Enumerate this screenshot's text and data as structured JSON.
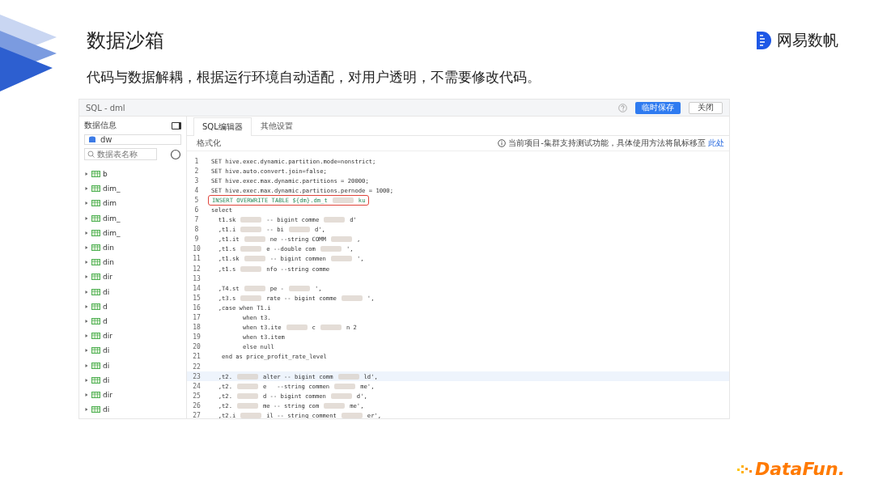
{
  "slide": {
    "title": "数据沙箱",
    "subtitle": "代码与数据解耦，根据运行环境自动适配，对用户透明，不需要修改代码。",
    "brand": "网易数帆",
    "footer_logo": "DataFun."
  },
  "window": {
    "title": "SQL - dml",
    "buttons": [
      {
        "label": "临时保存",
        "kind": "primary"
      },
      {
        "label": "关闭",
        "kind": "default"
      }
    ]
  },
  "sidebar": {
    "title": "数据信息",
    "database": "dw",
    "search": {
      "placeholder": "数据表名称"
    },
    "tables": [
      {
        "name": "b"
      },
      {
        "name": "dim_"
      },
      {
        "name": "dim"
      },
      {
        "name": "dim_"
      },
      {
        "name": "dim_"
      },
      {
        "name": "din"
      },
      {
        "name": "din"
      },
      {
        "name": "dir"
      },
      {
        "name": "di"
      },
      {
        "name": "d"
      },
      {
        "name": "d"
      },
      {
        "name": "dir"
      },
      {
        "name": "di"
      },
      {
        "name": "di"
      },
      {
        "name": "di"
      },
      {
        "name": "dir"
      },
      {
        "name": "di"
      }
    ]
  },
  "tabs": [
    {
      "label": "SQL编辑器",
      "selected": true
    },
    {
      "label": "其他设置",
      "selected": false
    }
  ],
  "toolbar": {
    "format": "格式化",
    "notice": "当前项目-集群支持测试功能，具体使用方法将鼠标移至",
    "notice_link": "此处"
  },
  "code": [
    {
      "n": "1",
      "parts": [
        "SET hive.exec.dynamic.partition.mode=nonstrict;"
      ],
      "boxed": false,
      "current": false
    },
    {
      "n": "2",
      "parts": [
        "SET hive.auto.convert.join=false;"
      ],
      "boxed": false,
      "current": false
    },
    {
      "n": "3",
      "parts": [
        "SET hive.exec.max.dynamic.partitions = 20000;"
      ],
      "boxed": false,
      "current": false
    },
    {
      "n": "4",
      "parts": [
        "SET hive.exec.max.dynamic.partitions.pernode = 1000;"
      ],
      "boxed": false,
      "current": false
    },
    {
      "n": "5",
      "parts": [
        "INSERT OVERWRITE TABLE ${dm}.dm_t",
        "ku"
      ],
      "boxed": true,
      "current": false
    },
    {
      "n": "6",
      "parts": [
        "select"
      ],
      "boxed": false,
      "current": false
    },
    {
      "n": "7",
      "parts": [
        "  t1.sk",
        "-- bigint comme",
        "d'"
      ],
      "boxed": false,
      "current": false
    },
    {
      "n": "8",
      "parts": [
        "  ,t1.i",
        "-- bi",
        "d',"
      ],
      "boxed": false,
      "current": false
    },
    {
      "n": "9",
      "parts": [
        "  ,t1.it",
        "ne --string COMM",
        ","
      ],
      "boxed": false,
      "current": false
    },
    {
      "n": "10",
      "parts": [
        "  ,t1.s",
        "e --double com",
        "',"
      ],
      "boxed": false,
      "current": false
    },
    {
      "n": "11",
      "parts": [
        "  ,t1.sk",
        "-- bigint commen",
        "',"
      ],
      "boxed": false,
      "current": false
    },
    {
      "n": "12",
      "parts": [
        "  ,t1.s",
        "nfo --string comme"
      ],
      "boxed": false,
      "current": false
    },
    {
      "n": "13",
      "boxed": false,
      "current": false
    },
    {
      "n": "14",
      "parts": [
        "  ,T4.st",
        "pe -",
        "',"
      ],
      "boxed": false,
      "current": false
    },
    {
      "n": "15",
      "parts": [
        "  ,t3.s",
        "rate -- bigint comme",
        "',"
      ],
      "boxed": false,
      "current": false
    },
    {
      "n": "16",
      "parts": [
        "  ,case when T1.i"
      ],
      "boxed": false,
      "current": false
    },
    {
      "n": "17",
      "parts": [
        "         when t3."
      ],
      "boxed": false,
      "current": false
    },
    {
      "n": "18",
      "parts": [
        "         when t3.ite",
        "c",
        "n 2"
      ],
      "boxed": false,
      "current": false
    },
    {
      "n": "19",
      "parts": [
        "         when t3.item"
      ],
      "boxed": false,
      "current": false
    },
    {
      "n": "20",
      "parts": [
        "         else null"
      ],
      "boxed": false,
      "current": false
    },
    {
      "n": "21",
      "parts": [
        "   end as price_profit_rate_level"
      ],
      "boxed": false,
      "current": false
    },
    {
      "n": "22",
      "boxed": false,
      "current": false
    },
    {
      "n": "23",
      "parts": [
        "  ,t2.",
        "alter -- bigint comm",
        "ld',"
      ],
      "boxed": false,
      "current": true
    },
    {
      "n": "24",
      "parts": [
        "  ,t2.",
        "e   --string commen",
        "me',"
      ],
      "boxed": false,
      "current": false
    },
    {
      "n": "25",
      "parts": [
        "  ,t2.",
        "d -- bigint commen",
        "d',"
      ],
      "boxed": false,
      "current": false
    },
    {
      "n": "26",
      "parts": [
        "  ,t2.",
        "me -- string com",
        "me',"
      ],
      "boxed": false,
      "current": false
    },
    {
      "n": "27",
      "parts": [
        "  ,t2.i",
        "il -- string comment",
        "er',"
      ],
      "boxed": false,
      "current": false
    }
  ]
}
